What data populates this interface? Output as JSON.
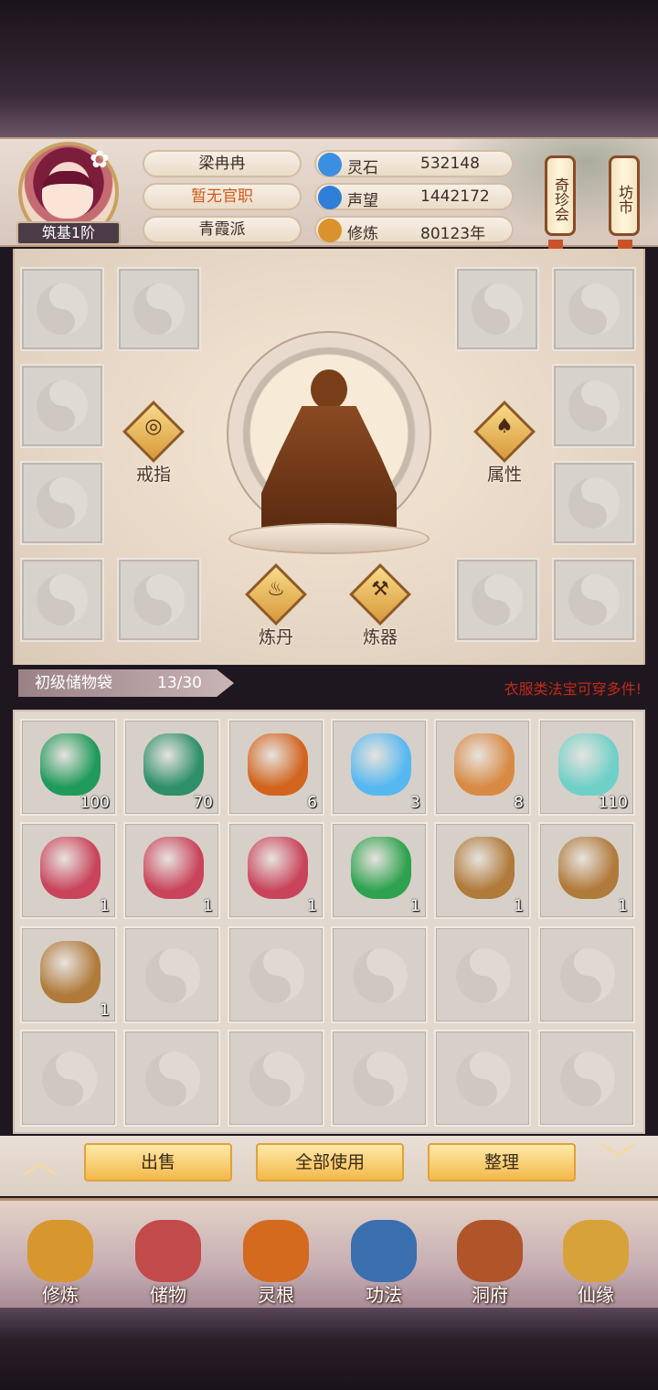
{
  "player": {
    "name": "梁冉冉",
    "title": "暂无官职",
    "sect": "青霞派",
    "rank": "筑基1阶"
  },
  "stats": [
    {
      "label": "灵石",
      "value": "532148",
      "icon": "spirit-stone-icon",
      "color": "#3b8fe0"
    },
    {
      "label": "声望",
      "value": "1442172",
      "icon": "reputation-icon",
      "color": "#2f7fd8"
    },
    {
      "label": "修炼",
      "value": "80123年",
      "icon": "meditation-icon",
      "color": "#d9922e"
    }
  ],
  "scroll_buttons": {
    "treasure": "奇珍会",
    "market": "坊市"
  },
  "equip_actions": {
    "ring": "戒指",
    "attributes": "属性",
    "alchemy": "炼丹",
    "forge": "炼器"
  },
  "storage": {
    "title": "初级储物袋",
    "count": "13/30",
    "hint": "衣服类法宝可穿多件!"
  },
  "items": [
    {
      "name": "green-crystal",
      "qty": "100",
      "color": "#1f9a5a"
    },
    {
      "name": "jade-gourd",
      "qty": "70",
      "color": "#2e8f6a"
    },
    {
      "name": "orange-gourd",
      "qty": "6",
      "color": "#d2641e"
    },
    {
      "name": "spirit-tea-bowl",
      "qty": "3",
      "color": "#56b8f0"
    },
    {
      "name": "copper-ring",
      "qty": "8",
      "color": "#d88a44"
    },
    {
      "name": "jade-whistle",
      "qty": "110",
      "color": "#6fd0c8"
    },
    {
      "name": "scroll-bundle",
      "qty": "1",
      "color": "#c9435a"
    },
    {
      "name": "scroll-bundle",
      "qty": "1",
      "color": "#c9435a"
    },
    {
      "name": "scroll-bundle",
      "qty": "1",
      "color": "#c9435a"
    },
    {
      "name": "green-scroll",
      "qty": "1",
      "color": "#2ea24e"
    },
    {
      "name": "spirit-pouch",
      "qty": "1",
      "color": "#b07a3a"
    },
    {
      "name": "spirit-pouch",
      "qty": "1",
      "color": "#b07a3a"
    },
    {
      "name": "spirit-pouch",
      "qty": "1",
      "color": "#b07a3a"
    }
  ],
  "actions": {
    "sell": "出售",
    "use_all": "全部使用",
    "sort": "整理"
  },
  "nav": [
    {
      "label": "修炼",
      "icon": "cultivate-icon",
      "color": "#d8962e"
    },
    {
      "label": "储物",
      "icon": "storage-bag-icon",
      "color": "#c24a4a"
    },
    {
      "label": "灵根",
      "icon": "spirit-root-icon",
      "color": "#d36a1e"
    },
    {
      "label": "功法",
      "icon": "technique-book-icon",
      "color": "#3a6fb0"
    },
    {
      "label": "洞府",
      "icon": "cave-dwelling-icon",
      "color": "#b0542a"
    },
    {
      "label": "仙缘",
      "icon": "fortune-gourd-icon",
      "color": "#d8a23a"
    }
  ]
}
